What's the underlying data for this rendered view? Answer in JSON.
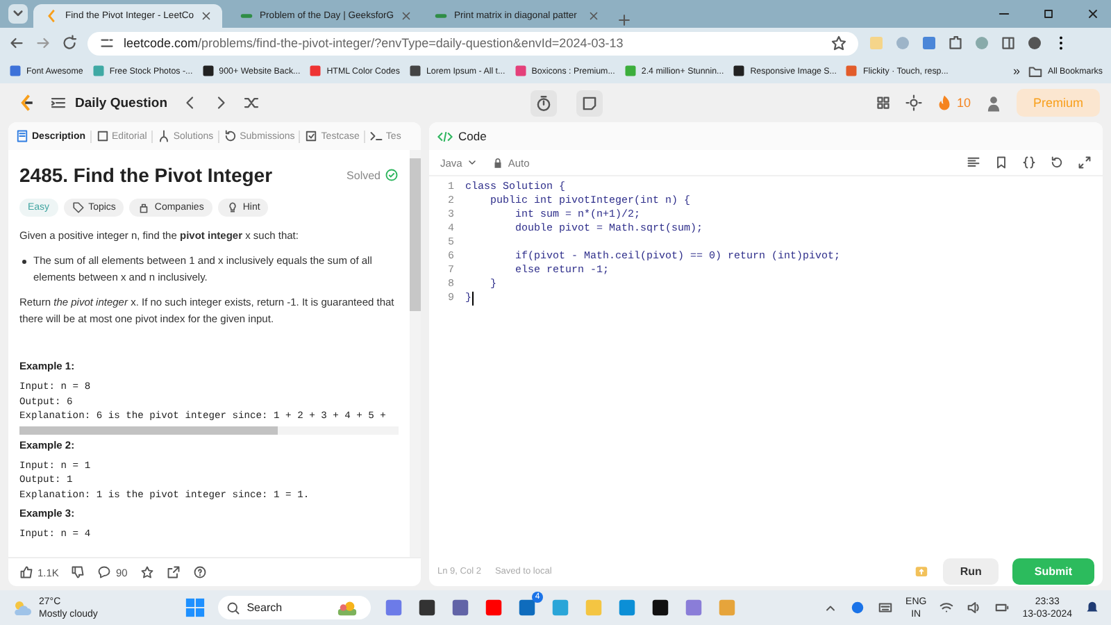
{
  "browser": {
    "tabs": [
      {
        "title": "Find the Pivot Integer - LeetCo",
        "selected": true
      },
      {
        "title": "Problem of the Day | GeeksforG",
        "selected": false
      },
      {
        "title": "Print matrix in diagonal patter",
        "selected": false
      }
    ],
    "url_host": "leetcode.com",
    "url_path": "/problems/find-the-pivot-integer/?envType=daily-question&envId=2024-03-13",
    "bookmarks": [
      "Font Awesome",
      "Free Stock Photos -...",
      "900+ Website Back...",
      "HTML Color Codes",
      "Lorem Ipsum - All t...",
      "Boxicons : Premium...",
      "2.4 million+ Stunnin...",
      "Responsive Image S...",
      "Flickity · Touch, resp..."
    ],
    "bookmarks_more": "»",
    "all_bookmarks": "All Bookmarks"
  },
  "header": {
    "title": "Daily Question",
    "streak": "10",
    "premium": "Premium"
  },
  "left": {
    "tabs": [
      {
        "label": "Description",
        "selected": true
      },
      {
        "label": "Editorial",
        "selected": false
      },
      {
        "label": "Solutions",
        "selected": false
      },
      {
        "label": "Submissions",
        "selected": false
      },
      {
        "label": "Testcase",
        "selected": false
      },
      {
        "label": "Tes",
        "selected": false
      }
    ],
    "title": "2485. Find the Pivot Integer",
    "status": "Solved",
    "difficulty": "Easy",
    "tags": [
      "Topics",
      "Companies",
      "Hint"
    ],
    "intro": "Given a positive integer n, find the **pivot integer** x such that:",
    "bullets": [
      "The sum of all elements between 1 and x inclusively equals the sum of all elements between x and n inclusively."
    ],
    "note": "Return *the pivot integer* x. If no such integer exists, return -1. It is guaranteed that there will be at most one pivot index for the given input.",
    "examples": [
      {
        "title": "Example 1:",
        "lines": [
          "Input: n = 8",
          "Output: 6",
          "Explanation: 6 is the pivot integer since: 1 + 2 + 3 + 4 + 5 +"
        ],
        "scrollable": true
      },
      {
        "title": "Example 2:",
        "lines": [
          "Input: n = 1",
          "Output: 1",
          "Explanation: 1 is the pivot integer since: 1 = 1."
        ]
      },
      {
        "title": "Example 3:",
        "lines": [
          "Input: n = 4"
        ]
      }
    ],
    "likes": "1.1K",
    "comments": "90"
  },
  "editor": {
    "title": "Code",
    "language": "Java",
    "mode": "Auto",
    "lines": [
      {
        "no": "1",
        "code": "class Solution {"
      },
      {
        "no": "2",
        "code": "    public int pivotInteger(int n) {"
      },
      {
        "no": "3",
        "code": "        int sum = n*(n+1)/2;"
      },
      {
        "no": "4",
        "code": "        double pivot = Math.sqrt(sum);"
      },
      {
        "no": "5"
      },
      {
        "no": "6",
        "code": "        if(pivot - Math.ceil(pivot) == 0) return (int)pivot;"
      },
      {
        "no": "7",
        "code": "        else return -1;"
      },
      {
        "no": "8",
        "code": "    }"
      },
      {
        "no": "9",
        "code": "}"
      }
    ],
    "cursor": "Ln 9, Col 2",
    "saved": "Saved to local",
    "run": "Run",
    "submit": "Submit"
  },
  "taskbar": {
    "temperature": "27°C",
    "weather": "Mostly cloudy",
    "search": "Search",
    "mail_badge": "4",
    "language": "ENG",
    "region": "IN",
    "time": "23:33",
    "date": "13-03-2024"
  }
}
